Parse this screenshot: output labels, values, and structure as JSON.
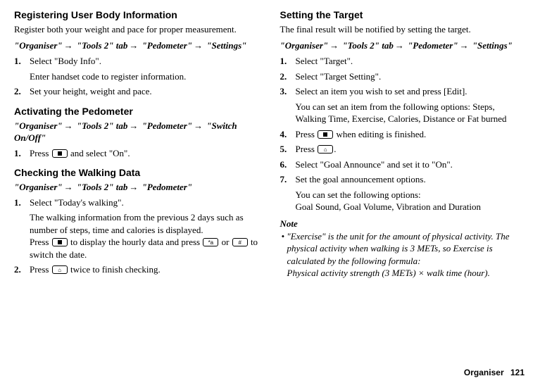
{
  "left": {
    "section1": {
      "heading": "Registering User Body Information",
      "intro": "Register both your weight and pace for proper measurement.",
      "path_parts": [
        "\"Organiser\"",
        "\"Tools 2\" tab",
        "\"Pedometer\"",
        "\"Settings\""
      ],
      "steps": [
        {
          "num": "1.",
          "text": "Select \"Body Info\".",
          "sub": "Enter handset code to register information."
        },
        {
          "num": "2.",
          "text": "Set your height, weight and pace."
        }
      ]
    },
    "section2": {
      "heading": "Activating the Pedometer",
      "path_parts": [
        "\"Organiser\"",
        "\"Tools 2\" tab",
        "\"Pedometer\"",
        "\"Switch On/Off\""
      ],
      "steps": [
        {
          "num": "1.",
          "pre": "Press ",
          "post": " and select \"On\"."
        }
      ]
    },
    "section3": {
      "heading": "Checking the Walking Data",
      "path_parts": [
        "\"Organiser\"",
        "\"Tools 2\" tab",
        "\"Pedometer\""
      ],
      "steps": [
        {
          "num": "1.",
          "text": "Select \"Today's walking\".",
          "sub_pre": "The walking information from the previous 2 days such as number of steps, time and calories is displayed.\nPress ",
          "sub_mid1": " to display the hourly data and press ",
          "sub_mid2": " or ",
          "sub_post": " to switch the date."
        },
        {
          "num": "2.",
          "pre": "Press ",
          "post": " twice to finish checking."
        }
      ],
      "key_star": "*a",
      "key_hash": "#",
      "key_clear_like": "⌂"
    }
  },
  "right": {
    "section1": {
      "heading": "Setting the Target",
      "intro": "The final result will be notified by setting the target.",
      "path_parts": [
        "\"Organiser\"",
        "\"Tools 2\" tab",
        "\"Pedometer\"",
        "\"Settings\""
      ],
      "steps": [
        {
          "num": "1.",
          "text": "Select \"Target\"."
        },
        {
          "num": "2.",
          "text": "Select \"Target Setting\"."
        },
        {
          "num": "3.",
          "text": "Select an item you wish to set and press [Edit].",
          "sub": "You can set an item from the following options: Steps, Walking Time, Exercise, Calories, Distance or Fat burned"
        },
        {
          "num": "4.",
          "pre": "Press ",
          "post": " when editing is finished."
        },
        {
          "num": "5.",
          "pre": "Press ",
          "post": "."
        },
        {
          "num": "6.",
          "text": "Select \"Goal Announce\" and set it to \"On\"."
        },
        {
          "num": "7.",
          "text": "Set the goal announcement options.",
          "sub": "You can set the following options:\nGoal Sound, Goal Volume, Vibration and Duration"
        }
      ],
      "key_clear_like": "⌂"
    },
    "note": {
      "label": "Note",
      "body": "• \"Exercise\" is the unit for the amount of physical activity. The physical activity when walking is 3 METs, so Exercise is calculated by the following formula:\nPhysical activity strength (3 METs) × walk time (hour)."
    }
  },
  "footer": {
    "label": "Organiser",
    "page": "121"
  }
}
